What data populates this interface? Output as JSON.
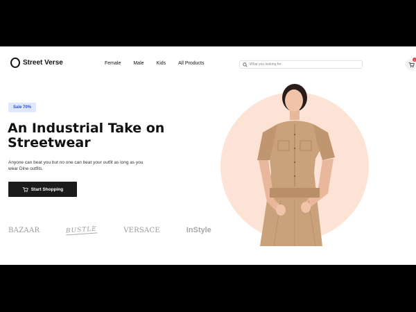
{
  "header": {
    "logo_text": "Street Verse",
    "nav": [
      "Female",
      "Male",
      "Kids",
      "All Products"
    ],
    "search_placeholder": "What you looking for",
    "cart_count": "1"
  },
  "hero": {
    "badge": "Sale 70%",
    "title_line1": "An Industrial Take on",
    "title_line2": "Streetwear",
    "description": "Anyone can beat you but no one can beat your outfit as long as you wear Dine outfits.",
    "cta_label": "Start Shopping",
    "brands": [
      "BAZAAR",
      "BUSTLE",
      "VERSACE",
      "InStyle"
    ]
  },
  "colors": {
    "accent_badge_bg": "#dfe8ff",
    "accent_badge_text": "#2d4fd6",
    "hero_circle": "#fde3d6",
    "cta_bg": "#1b1b1b"
  }
}
